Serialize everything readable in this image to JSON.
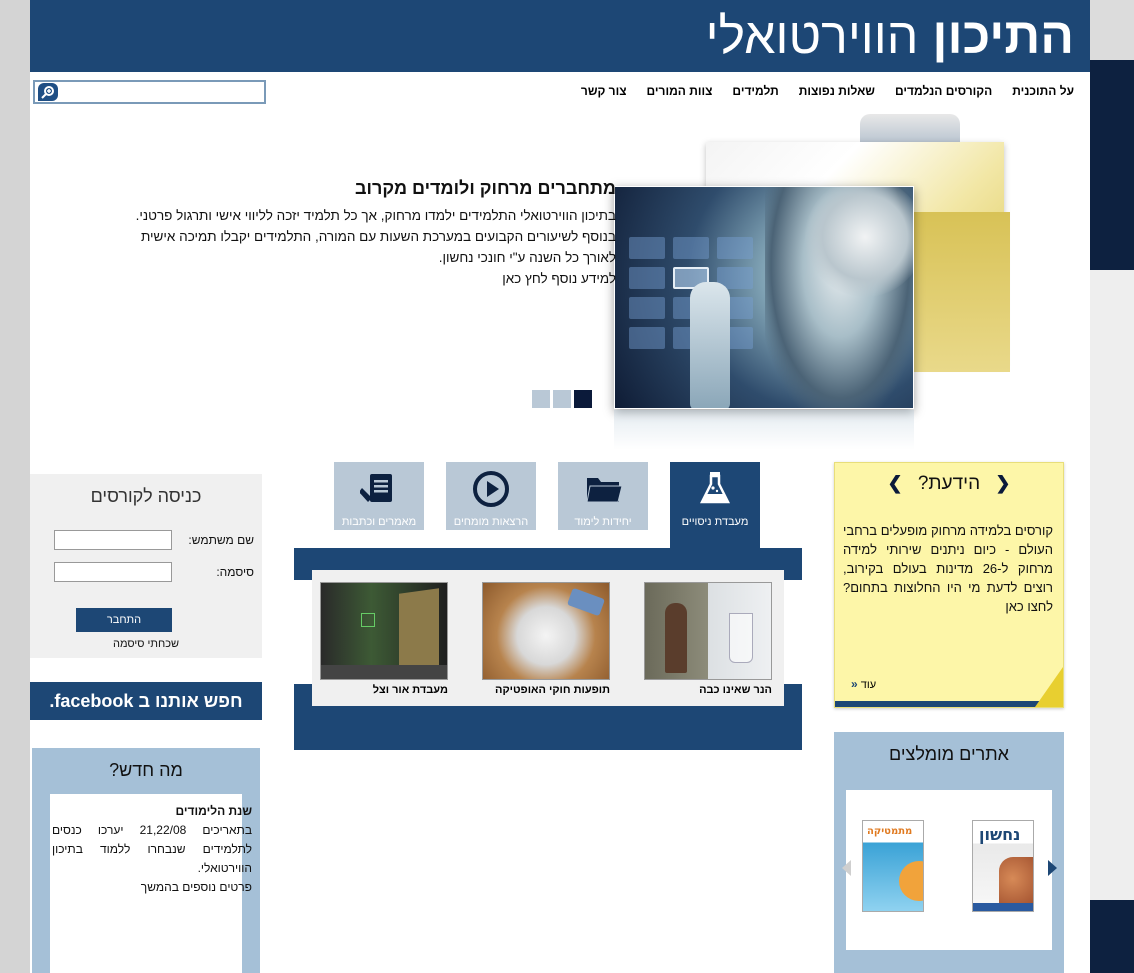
{
  "header": {
    "logo_bold": "התיכון",
    "logo_light": "הווירטואלי"
  },
  "nav": {
    "items": [
      "על התוכנית",
      "הקורסים הנלמדים",
      "שאלות נפוצות",
      "תלמידים",
      "צוות המורים",
      "צור קשר"
    ]
  },
  "search": {
    "placeholder": ""
  },
  "hero": {
    "title": "מתחברים מרחוק ולומדים מקרוב",
    "body": "בתיכון הווירטואלי התלמידים ילמדו מרחוק, אך כל תלמיד יזכה לליווי אישי ותרגול פרטני. בנוסף לשיעורים הקבועים במערכת השעות עם המורה, התלמידים יקבלו תמיכה אישית לאורך כל השנה ע\"י חונכי נחשון.",
    "more": "למידע נוסף לחץ כאן",
    "slides": 3,
    "active_slide": 3
  },
  "did_you_know": {
    "title": "הידעת?",
    "body": "קורסים בלמידה מרחוק מופעלים ברחבי העולם - כיום ניתנים שירותי למידה מרחוק ל-26 מדינות בעולם בקירוב, רוצים לדעת מי היו החלוצות בתחום? לחצו כאן",
    "more": "עוד"
  },
  "tabs": [
    {
      "label": "מעבדת ניסויים",
      "icon": "flask-icon",
      "active": true
    },
    {
      "label": "יחידות לימוד",
      "icon": "folder-icon",
      "active": false
    },
    {
      "label": "הרצאות מומחים",
      "icon": "play-icon",
      "active": false
    },
    {
      "label": "מאמרים וכתבות",
      "icon": "document-edit-icon",
      "active": false
    }
  ],
  "media": [
    {
      "caption": "הנר שאינו כבה"
    },
    {
      "caption": "תופעות חוקי האופטיקה"
    },
    {
      "caption": "מעבדת אור וצל"
    }
  ],
  "login": {
    "title": "כניסה לקורסים",
    "username_label": "שם משתמש:",
    "password_label": "סיסמה:",
    "button": "התחבר",
    "forgot": "שכחתי סיסמה"
  },
  "facebook": {
    "prefix": "חפש אותנו ב",
    "brand": "facebook."
  },
  "news": {
    "title": "מה חדש?",
    "heading": "שנת הלימודים",
    "body": "בתאריכים 21,22/08 יערכו כנסים לתלמידים שנבחרו ללמוד בתיכון הווירטואלי.",
    "more": "פרטים נוספים בהמשך"
  },
  "recommended": {
    "title": "אתרים מומלצים",
    "books": [
      "נחשון",
      "מתמטיקה"
    ]
  },
  "colors": {
    "brand": "#1d4775",
    "light_blue": "#a5c0d7",
    "note_yellow": "#fdf6a8"
  }
}
